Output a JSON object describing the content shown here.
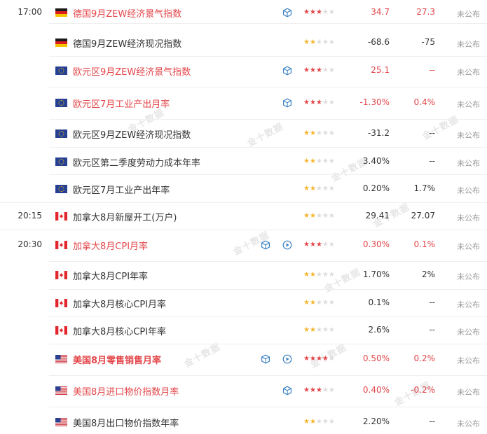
{
  "watermark_text": "金十数据",
  "colors": {
    "accent_red": "#e3464a",
    "star_yellow": "#f6b52e",
    "star_off": "#dcdcdc",
    "muted": "#999999"
  },
  "events": [
    {
      "time": "17:00",
      "flag": "germany",
      "name": "德国9月ZEW经济景气指数",
      "red": true,
      "bold": false,
      "icons": [
        "cube-icon"
      ],
      "stars": 3,
      "stars_color": "red",
      "actual": "34.7",
      "actual_red": true,
      "forecast": "27.3",
      "forecast_red": true,
      "status": "未公布"
    },
    {
      "time": "",
      "flag": "germany",
      "name": "德国9月ZEW经济现况指数",
      "red": false,
      "bold": false,
      "icons": [],
      "stars": 2,
      "stars_color": "yellow",
      "actual": "-68.6",
      "actual_red": false,
      "forecast": "-75",
      "forecast_red": false,
      "status": "未公布"
    },
    {
      "time": "",
      "flag": "eu",
      "name": "欧元区9月ZEW经济景气指数",
      "red": true,
      "bold": false,
      "icons": [
        "cube-icon"
      ],
      "stars": 3,
      "stars_color": "red",
      "actual": "25.1",
      "actual_red": true,
      "forecast": "--",
      "forecast_red": true,
      "status": "未公布"
    },
    {
      "time": "",
      "flag": "eu",
      "name": "欧元区7月工业产出月率",
      "red": true,
      "bold": false,
      "icons": [
        "cube-icon"
      ],
      "stars": 3,
      "stars_color": "red",
      "actual": "-1.30%",
      "actual_red": true,
      "forecast": "0.4%",
      "forecast_red": true,
      "status": "未公布"
    },
    {
      "time": "",
      "flag": "eu",
      "name": "欧元区9月ZEW经济现况指数",
      "red": false,
      "bold": false,
      "icons": [],
      "stars": 2,
      "stars_color": "yellow",
      "actual": "-31.2",
      "actual_red": false,
      "forecast": "--",
      "forecast_red": false,
      "status": "未公布"
    },
    {
      "time": "",
      "flag": "eu",
      "name": "欧元区第二季度劳动力成本年率",
      "red": false,
      "bold": false,
      "icons": [],
      "stars": 2,
      "stars_color": "yellow",
      "actual": "3.40%",
      "actual_red": false,
      "forecast": "--",
      "forecast_red": false,
      "status": "未公布"
    },
    {
      "time": "",
      "flag": "eu",
      "name": "欧元区7月工业产出年率",
      "red": false,
      "bold": false,
      "icons": [],
      "stars": 2,
      "stars_color": "yellow",
      "actual": "0.20%",
      "actual_red": false,
      "forecast": "1.7%",
      "forecast_red": false,
      "status": "未公布"
    },
    {
      "time": "20:15",
      "flag": "canada",
      "name": "加拿大8月新屋开工(万户)",
      "red": false,
      "bold": false,
      "icons": [],
      "stars": 2,
      "stars_color": "yellow",
      "actual": "29.41",
      "actual_red": false,
      "forecast": "27.07",
      "forecast_red": false,
      "status": "未公布"
    },
    {
      "time": "20:30",
      "flag": "canada",
      "name": "加拿大8月CPI月率",
      "red": true,
      "bold": false,
      "icons": [
        "cube-icon",
        "play-icon"
      ],
      "stars": 3,
      "stars_color": "red",
      "actual": "0.30%",
      "actual_red": true,
      "forecast": "0.1%",
      "forecast_red": true,
      "status": "未公布"
    },
    {
      "time": "",
      "flag": "canada",
      "name": "加拿大8月CPI年率",
      "red": false,
      "bold": false,
      "icons": [],
      "stars": 2,
      "stars_color": "yellow",
      "actual": "1.70%",
      "actual_red": false,
      "forecast": "2%",
      "forecast_red": false,
      "status": "未公布"
    },
    {
      "time": "",
      "flag": "canada",
      "name": "加拿大8月核心CPI月率",
      "red": false,
      "bold": false,
      "icons": [],
      "stars": 2,
      "stars_color": "yellow",
      "actual": "0.1%",
      "actual_red": false,
      "forecast": "--",
      "forecast_red": false,
      "status": "未公布"
    },
    {
      "time": "",
      "flag": "canada",
      "name": "加拿大8月核心CPI年率",
      "red": false,
      "bold": false,
      "icons": [],
      "stars": 2,
      "stars_color": "yellow",
      "actual": "2.6%",
      "actual_red": false,
      "forecast": "--",
      "forecast_red": false,
      "status": "未公布"
    },
    {
      "time": "",
      "flag": "usa",
      "name": "美国8月零售销售月率",
      "red": true,
      "bold": true,
      "icons": [
        "cube-icon",
        "play-icon"
      ],
      "stars": 4,
      "stars_color": "red",
      "actual": "0.50%",
      "actual_red": true,
      "forecast": "0.2%",
      "forecast_red": true,
      "status": "未公布"
    },
    {
      "time": "",
      "flag": "usa",
      "name": "美国8月进口物价指数月率",
      "red": true,
      "bold": false,
      "icons": [
        "cube-icon"
      ],
      "stars": 3,
      "stars_color": "red",
      "actual": "0.40%",
      "actual_red": true,
      "forecast": "-0.2%",
      "forecast_red": true,
      "status": "未公布"
    },
    {
      "time": "",
      "flag": "usa",
      "name": "美国8月出口物价指数年率",
      "red": false,
      "bold": false,
      "icons": [],
      "stars": 2,
      "stars_color": "yellow",
      "actual": "2.20%",
      "actual_red": false,
      "forecast": "--",
      "forecast_red": false,
      "status": "未公布"
    }
  ]
}
